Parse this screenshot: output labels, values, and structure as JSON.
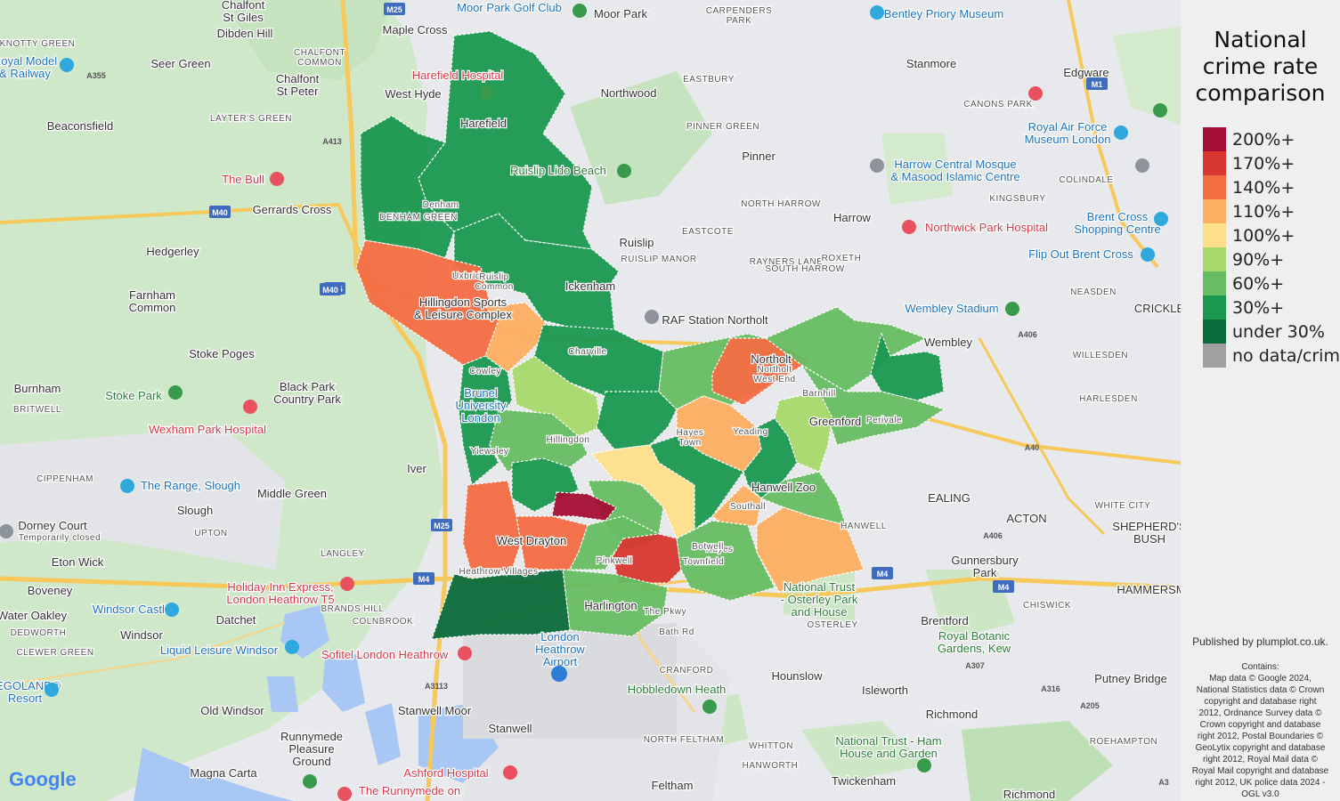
{
  "legend": {
    "title_lines": [
      "National",
      "crime rate",
      "comparison"
    ],
    "items": [
      {
        "label": "200%+",
        "color": "#a50f35"
      },
      {
        "label": "170%+",
        "color": "#d7372f"
      },
      {
        "label": "140%+",
        "color": "#f46d43"
      },
      {
        "label": "110%+",
        "color": "#fdae61"
      },
      {
        "label": "100%+",
        "color": "#fee08b"
      },
      {
        "label": "90%+",
        "color": "#a6d96a"
      },
      {
        "label": "60%+",
        "color": "#66bd63"
      },
      {
        "label": "30%+",
        "color": "#1a9850"
      },
      {
        "label": "under 30%",
        "color": "#0b6b3a"
      },
      {
        "label": "no data/crime",
        "color": "#a0a0a0"
      }
    ]
  },
  "published": "Published by plumplot.co.uk.",
  "credits": [
    "Contains:",
    "Map data © Google 2024,",
    "National Statistics data © Crown",
    "copyright and database right",
    "2012, Ordnance Survey data ©",
    "Crown copyright and database",
    "right 2012, Postal Boundaries ©",
    "GeoLytix copyright and database",
    "right 2012, Royal Mail data ©",
    "Royal Mail copyright and database",
    "right 2012, UK police data 2024 -",
    "OGL v3.0"
  ],
  "map_labels": {
    "l1": "Chalfont\nSt Giles",
    "l2": "Dibden Hill",
    "l3": "Maple Cross",
    "l4": "Moor Park",
    "l5": "Moor Park Golf Club",
    "l6": "CARPENDERS\nPARK",
    "l7": "Bentley Priory Museum",
    "l8": "KNOTTY GREEN",
    "l9": "Seer Green",
    "l10": "CHALFONT\nCOMMON",
    "l11": "Chalfont\nSt Peter",
    "l12": "Harefield Hospital",
    "l13": "West Hyde",
    "l14": "Northwood",
    "l15": "EASTBURY",
    "l16": "Stanmore",
    "l17": "Edgware",
    "l18": "Beaconsfield",
    "l19": "LAYTER'S GREEN",
    "l20": "Harefield",
    "l21": "PINNER GREEN",
    "l22": "CANONS PARK",
    "l23": "Royal Air Force\nMuseum London",
    "l24": "Pinner",
    "l25": "Harrow Central Mosque\n& Masood Islamic Centre",
    "l26": "KINGSBURY",
    "l27": "COLINDALE",
    "l28": "The Bull",
    "l29": "Gerrards Cross",
    "l30": "Ruislip Lido Beach",
    "l31": "DENHAM GREEN",
    "l32": "NORTH HARROW",
    "l33": "Harrow",
    "l34": "Northwick Park Hospital",
    "l35": "Brent Cross\nShopping Centre",
    "l36": "Hedgerley",
    "l37": "Ruislip",
    "l38": "EASTCOTE",
    "l39": "RAYNERS LANE",
    "l40": "ROXETH",
    "l41": "RUISLIP MANOR",
    "l42": "SOUTH HARROW",
    "l43": "Flip Out Brent Cross",
    "l44": "Farnham\nCommon",
    "l45": "Ickenham",
    "l46": "NEASDEN",
    "l47": "RAF Station Northolt",
    "l48": "Wembley Stadium",
    "l49": "CRICKLE",
    "l50": "Hillingdon Sports\n& Leisure Complex",
    "l51": "Wembley",
    "l52": "WILLESDEN",
    "l53": "Stoke Poges",
    "l54": "Northolt",
    "l55": "Burnham",
    "l56": "Stoke Park",
    "l57": "Black Park\nCountry Park",
    "l58": "BRITWELL",
    "l59": "HARLESDEN",
    "l60": "Wexham Park Hospital",
    "l61": "Brunel\nUniversity\nLondon",
    "l62": "Greenford",
    "l63": "Iver",
    "l64": "CIPPENHAM",
    "l65": "The Range, Slough",
    "l66": "Middle Green",
    "l67": "Hanwell Zoo",
    "l68": "EALING",
    "l69": "ACTON",
    "l70": "WHITE CITY",
    "l71": "SHEPHERD'S\nBUSH",
    "l72": "Slough",
    "l73": "UPTON",
    "l74": "Dorney Court",
    "l75": "Temporarily closed",
    "l76": "West Drayton",
    "l77": "HANWELL",
    "l78": "Eton Wick",
    "l79": "LANGLEY",
    "l80": "Gunnersbury\nPark",
    "l81": "HAMMERSM",
    "l82": "Boveney",
    "l83": "Holiday Inn Express,\nLondon Heathrow T5",
    "l84": "National Trust\n- Osterley Park\nand House",
    "l85": "Harlington",
    "l86": "CHISWICK",
    "l87": "Windsor Castle",
    "l88": "Datchet",
    "l89": "BRANDS HILL",
    "l90": "COLNBROOK",
    "l91": "Water Oakley",
    "l92": "DEDWORTH",
    "l93": "Windsor",
    "l94": "OSTERLEY",
    "l95": "Brentford",
    "l96": "Royal Botanic\nGardens, Kew",
    "l97": "Sofitel London Heathrow",
    "l98": "London\nHeathrow\nAirport",
    "l99": "CLEWER GREEN",
    "l100": "Liquid Leisure Windsor",
    "l101": "Bath Rd",
    "l102": "CRANFORD",
    "l103": "Hounslow",
    "l104": "Isleworth",
    "l105": "Putney Bridge",
    "l106": "Hobbledown Heath",
    "l107": "Old Windsor",
    "l108": "Stanwell Moor",
    "l109": "Richmond",
    "l110": "Stanwell",
    "l111": "NORTH FELTHAM",
    "l112": "WHITTON",
    "l113": "National Trust - Ham\nHouse and Garden",
    "l114": "ROEHAMPTON",
    "l115": "Runnymede\nPleasure\nGround",
    "l116": "Magna Carta",
    "l117": "Ashford Hospital",
    "l118": "HANWORTH",
    "l119": "Feltham",
    "l120": "Twickenham",
    "l121": "The Runnymede on",
    "l122": "Richmond",
    "l123": "LEGOLAND®\nResort",
    "l124": "Royal Model\n& Railway",
    "l125": "The Pkwy",
    "l126": "Hayes",
    "l127": "Southall",
    "l128": "Hillingdon",
    "l129": "Uxbridge",
    "l130": "Hayes\nTown",
    "l131": "Yeading",
    "l132": "Yiewsley",
    "l133": "Cowley",
    "l134": "Denham",
    "l135": "Ruislip\nCommon",
    "l136": "Heathrow Villages",
    "l137": "Pinkwell",
    "l138": "Charville",
    "l139": "Barnhill",
    "l140": "Botwell",
    "l141": "Townfield",
    "l142": "Northolt\nWest End",
    "l143": "Perivale"
  },
  "road_labels": [
    "M25",
    "M40",
    "M25",
    "M40",
    "M25",
    "M4",
    "M4",
    "M1",
    "A355",
    "A413",
    "A406",
    "A40",
    "A406",
    "A307",
    "A316",
    "A205",
    "A3",
    "A3113",
    "M4"
  ],
  "google_logo": "Google"
}
